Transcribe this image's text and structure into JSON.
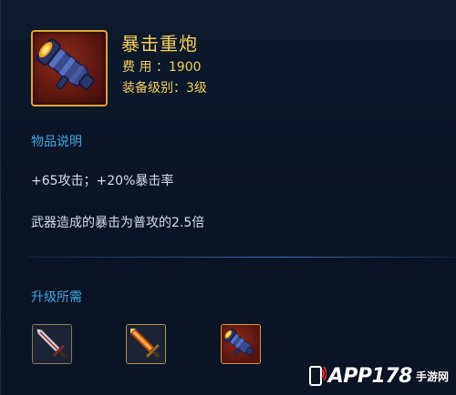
{
  "item": {
    "name": "暴击重炮",
    "cost": "费 用 ：1900",
    "level": "装备级别：3级",
    "icon": "cannon-icon"
  },
  "description": {
    "label": "物品说明",
    "line1": "+65攻击；+20%暴击率",
    "line2": "武器造成的暴击为普攻的2.5倍"
  },
  "upgrade": {
    "label": "升级所需",
    "slots": [
      {
        "icon": "sword-icon"
      },
      {
        "icon": "flame-sword-icon"
      },
      {
        "icon": "cannon-icon"
      }
    ]
  },
  "watermark": {
    "brand": "APP178",
    "site": "手游网"
  },
  "colors": {
    "title": "#f2cf58",
    "section": "#3fa6e6",
    "text": "#d5dde8",
    "background": "#0b1526"
  }
}
